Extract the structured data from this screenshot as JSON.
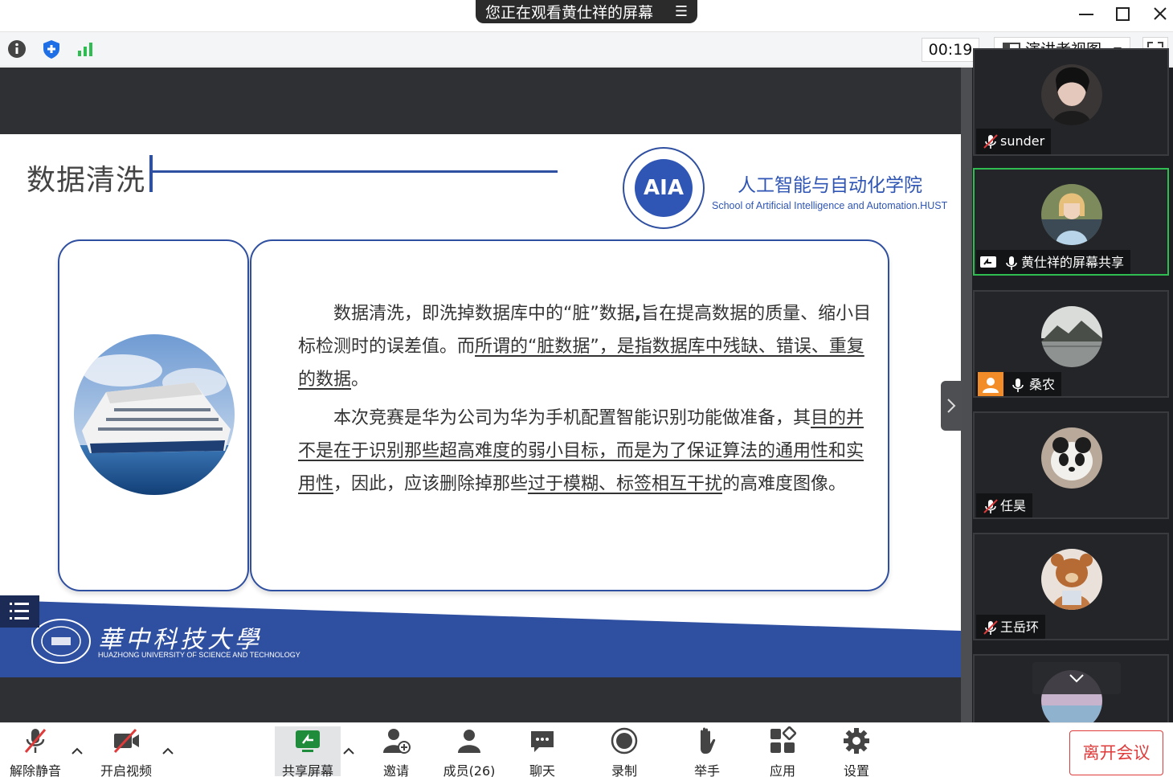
{
  "title_bar": {
    "share_banner": "您正在观看黄仕祥的屏幕",
    "minimize_icon": "minimize-icon",
    "maximize_icon": "maximize-icon",
    "close_icon": "close-icon"
  },
  "toolbar": {
    "icons": [
      "info-icon",
      "shield-icon",
      "signal-icon"
    ],
    "timer": "00:19",
    "view_label": "演讲者视图",
    "fullscreen_icon": "fullscreen-icon"
  },
  "slide": {
    "title": "数据清洗",
    "logo_text": "AIA",
    "school_cn": "人工智能与自动化学院",
    "school_en": "School of Artificial Intelligence and Automation.HUST",
    "para1": [
      {
        "t": "数据清洗，即洗掉数据库中的“脏”数据",
        "u": false
      },
      {
        "t": ",",
        "u": false,
        "b": true
      },
      {
        "t": "旨在提高数据的质量、缩小目标检测时的误差值。而",
        "u": false
      },
      {
        "t": "所谓的“脏数据”，是指数据库中残缺、错误、重复的数据",
        "u": true
      },
      {
        "t": "。",
        "u": false
      }
    ],
    "para2": [
      {
        "t": "本次竞赛是华为公司为华为手机配置智能识别功能做准备，其",
        "u": false
      },
      {
        "t": "目的并不是在于识别那些超高难度的弱小目标，而是为了保证算法的通用性和实用性",
        "u": true
      },
      {
        "t": "，因此，应该删除掉那些",
        "u": false
      },
      {
        "t": "过于模糊、标签相互干扰",
        "u": true
      },
      {
        "t": "的高难度图像。",
        "u": false
      }
    ],
    "footer_cn": "華中科技大學",
    "footer_en": "HUAZHONG UNIVERSITY OF SCIENCE AND TECHNOLOGY"
  },
  "participants": [
    {
      "name": "sunder",
      "muted": true,
      "sharing": false,
      "active": false
    },
    {
      "name": "黄仕祥的屏幕共享",
      "muted": false,
      "sharing": true,
      "active": true
    },
    {
      "name": "桑农",
      "muted": false,
      "sharing": false,
      "active": false,
      "default_avatar": true
    },
    {
      "name": "任昊",
      "muted": true,
      "sharing": false,
      "active": false
    },
    {
      "name": "王岳环",
      "muted": true,
      "sharing": false,
      "active": false
    }
  ],
  "bottom_bar": {
    "unmute": "解除静音",
    "start_video": "开启视频",
    "share_screen": "共享屏幕",
    "invite": "邀请",
    "members": "成员(26)",
    "chat": "聊天",
    "record": "录制",
    "raise_hand": "举手",
    "apps": "应用",
    "settings": "设置",
    "leave": "离开会议"
  },
  "colors": {
    "accent_blue": "#2f4fa0",
    "active_green": "#2fbd52",
    "leave_red": "#e03b3b"
  }
}
